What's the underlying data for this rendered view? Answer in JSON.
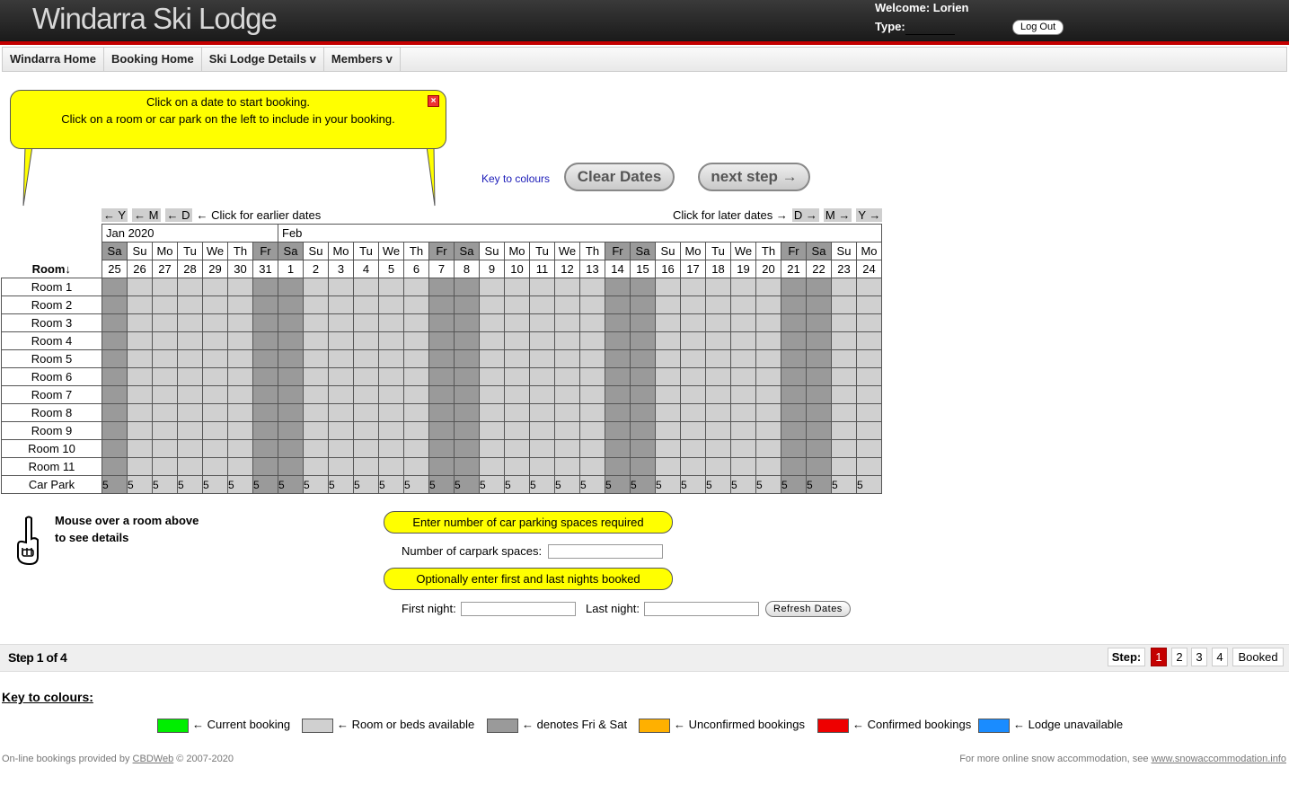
{
  "header": {
    "title": "Windarra Ski Lodge",
    "welcome": "Welcome: Lorien",
    "type_label": "Type:",
    "logout_label": "Log Out"
  },
  "nav": [
    "Windarra Home",
    "Booking Home",
    "Ski Lodge Details v",
    "Members v"
  ],
  "bubble": {
    "line1": "Click on a date to start booking.",
    "line2": "Click on a room or car park on the left to include in your booking."
  },
  "key_link": "Key to colours",
  "buttons": {
    "clear": "Clear Dates",
    "next": "next step →"
  },
  "earlier": {
    "y": "← Y",
    "m": "← M",
    "d": "← D",
    "text": "← Click for earlier dates"
  },
  "later": {
    "text": "Click for later dates →",
    "d": "D →",
    "m": "M →",
    "y": "Y →"
  },
  "calendar": {
    "months": [
      {
        "label": "Jan 2020",
        "span": 7
      },
      {
        "label": "Feb",
        "span": 24
      }
    ],
    "room_header": "Room↓",
    "days": [
      {
        "dow": "Sa",
        "date": "25",
        "weekend": true
      },
      {
        "dow": "Su",
        "date": "26",
        "weekend": false
      },
      {
        "dow": "Mo",
        "date": "27",
        "weekend": false
      },
      {
        "dow": "Tu",
        "date": "28",
        "weekend": false
      },
      {
        "dow": "We",
        "date": "29",
        "weekend": false
      },
      {
        "dow": "Th",
        "date": "30",
        "weekend": false
      },
      {
        "dow": "Fr",
        "date": "31",
        "weekend": true
      },
      {
        "dow": "Sa",
        "date": "1",
        "weekend": true
      },
      {
        "dow": "Su",
        "date": "2",
        "weekend": false
      },
      {
        "dow": "Mo",
        "date": "3",
        "weekend": false
      },
      {
        "dow": "Tu",
        "date": "4",
        "weekend": false
      },
      {
        "dow": "We",
        "date": "5",
        "weekend": false
      },
      {
        "dow": "Th",
        "date": "6",
        "weekend": false
      },
      {
        "dow": "Fr",
        "date": "7",
        "weekend": true
      },
      {
        "dow": "Sa",
        "date": "8",
        "weekend": true
      },
      {
        "dow": "Su",
        "date": "9",
        "weekend": false
      },
      {
        "dow": "Mo",
        "date": "10",
        "weekend": false
      },
      {
        "dow": "Tu",
        "date": "11",
        "weekend": false
      },
      {
        "dow": "We",
        "date": "12",
        "weekend": false
      },
      {
        "dow": "Th",
        "date": "13",
        "weekend": false
      },
      {
        "dow": "Fr",
        "date": "14",
        "weekend": true
      },
      {
        "dow": "Sa",
        "date": "15",
        "weekend": true
      },
      {
        "dow": "Su",
        "date": "16",
        "weekend": false
      },
      {
        "dow": "Mo",
        "date": "17",
        "weekend": false
      },
      {
        "dow": "Tu",
        "date": "18",
        "weekend": false
      },
      {
        "dow": "We",
        "date": "19",
        "weekend": false
      },
      {
        "dow": "Th",
        "date": "20",
        "weekend": false
      },
      {
        "dow": "Fr",
        "date": "21",
        "weekend": true
      },
      {
        "dow": "Sa",
        "date": "22",
        "weekend": true
      },
      {
        "dow": "Su",
        "date": "23",
        "weekend": false
      },
      {
        "dow": "Mo",
        "date": "24",
        "weekend": false
      }
    ],
    "rooms": [
      "Room 1",
      "Room 2",
      "Room 3",
      "Room 4",
      "Room 5",
      "Room 6",
      "Room 7",
      "Room 8",
      "Room 9",
      "Room 10",
      "Room 11"
    ],
    "carpark": {
      "label": "Car Park",
      "value": "5"
    }
  },
  "mouse_note": {
    "line1": "Mouse over a room above",
    "line2": "to see details"
  },
  "carpark_form": {
    "bar1": "Enter number of car parking spaces required",
    "spaces_label": "Number of carpark spaces:",
    "bar2": "Optionally enter first and last nights booked",
    "first_label": "First night:",
    "last_label": "Last night:",
    "refresh": "Refresh Dates"
  },
  "steps": {
    "text": "Step 1 of 4",
    "label": "Step:",
    "items": [
      "1",
      "2",
      "3",
      "4",
      "Booked"
    ],
    "active": "1"
  },
  "key": {
    "heading": "Key to colours:",
    "items": [
      {
        "color": "#00ee00",
        "label": "← Current booking"
      },
      {
        "color": "#d0d0d0",
        "label": "← Room or beds available"
      },
      {
        "color": "#9a9a9a",
        "label": "← denotes Fri & Sat"
      },
      {
        "color": "#ffb000",
        "label": "← Unconfirmed bookings"
      },
      {
        "color": "#ee0000",
        "label": "← Confirmed bookings"
      },
      {
        "color": "#1a8cff",
        "label": "← Lodge unavailable"
      }
    ]
  },
  "footer": {
    "left_pre": "On-line bookings provided by",
    "left_link": "CBDWeb",
    "left_post": "© 2007-2020",
    "right_pre": "For more online snow accommodation, see",
    "right_link": "www.snowaccommodation.info"
  }
}
